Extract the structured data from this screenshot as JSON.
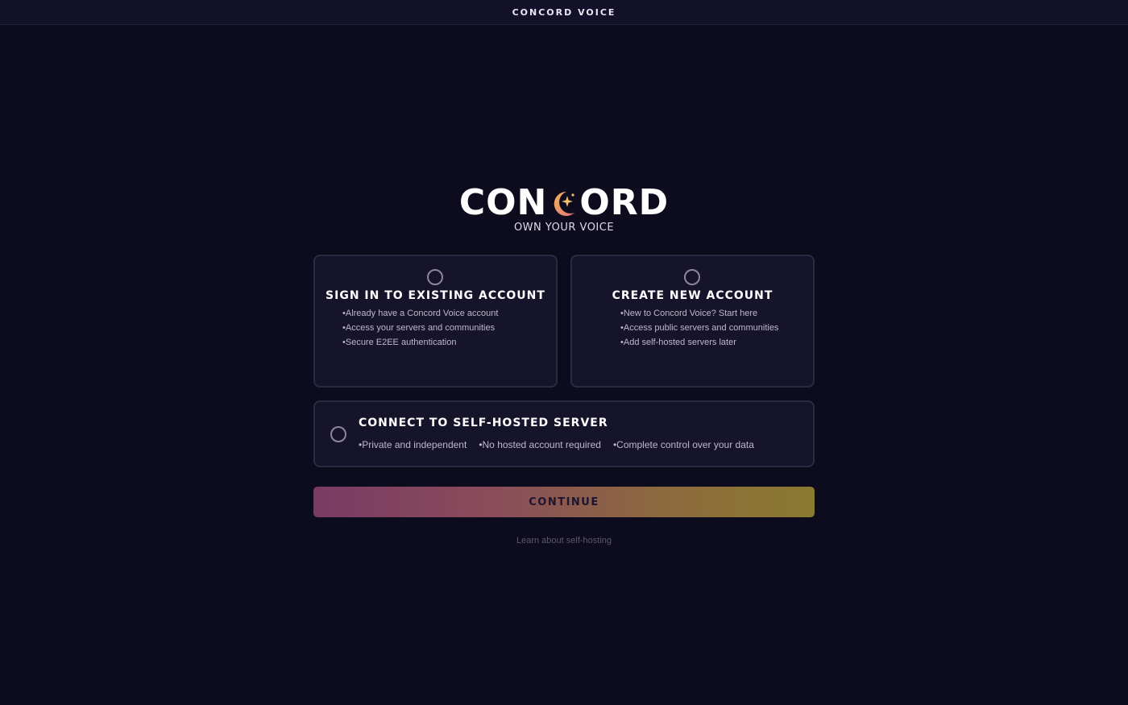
{
  "window": {
    "title": "CONCORD VOICE"
  },
  "branding": {
    "logo_left": "CON",
    "logo_right": "ORD",
    "logo_icon": "crescent-moon-star-icon",
    "tagline": "OWN YOUR VOICE",
    "accent_colors": [
      "#f0b25a",
      "#e07a7a"
    ]
  },
  "options": {
    "sign_in": {
      "title": "SIGN IN TO EXISTING ACCOUNT",
      "bullets": [
        "Already have a Concord Voice account",
        "Access your servers and communities",
        "Secure E2EE authentication"
      ],
      "selected": false
    },
    "create": {
      "title": "CREATE NEW ACCOUNT",
      "bullets": [
        "New to Concord Voice? Start here",
        "Access public servers and communities",
        "Add self-hosted servers later"
      ],
      "selected": false
    },
    "self_hosted": {
      "title": "CONNECT TO SELF-HOSTED SERVER",
      "bullets": [
        "Private and independent",
        "No hosted account required",
        "Complete control over your data"
      ],
      "selected": false
    }
  },
  "actions": {
    "continue_label": "CONTINUE",
    "continue_gradient": [
      "#7a3a64",
      "#8a7a30"
    ],
    "learn_link": "Learn about self-hosting"
  },
  "colors": {
    "background": "#0d0b1e",
    "card": "#16142b",
    "card_border": "#2c2a42"
  }
}
